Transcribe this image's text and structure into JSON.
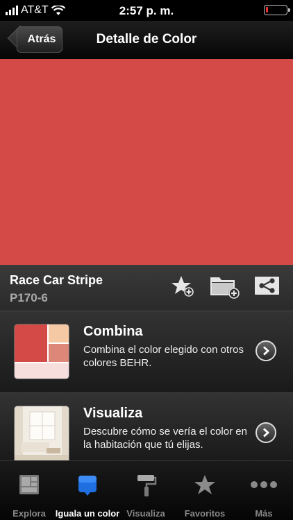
{
  "status_bar": {
    "carrier": "AT&T",
    "time": "2:57 p. m."
  },
  "nav": {
    "back_label": "Atrás",
    "title": "Detalle de Color"
  },
  "color": {
    "hex": "#d44a47",
    "name": "Race Car Stripe",
    "code": "P170-6"
  },
  "palette": {
    "main": "#d44a47",
    "light_peach": "#f6c9a5",
    "coral": "#dd8778",
    "pale_pink": "#f6dedc"
  },
  "actions": {
    "favorite_icon": "star-plus-icon",
    "folder_icon": "folder-plus-icon",
    "share_icon": "share-icon"
  },
  "features": [
    {
      "title": "Combina",
      "description": "Combina el color elegido con otros colores BEHR."
    },
    {
      "title": "Visualiza",
      "description": "Descubre cómo se vería el color en la habitación que tú elijas."
    }
  ],
  "tabs": [
    {
      "label": "Explora",
      "icon": "explore-icon",
      "active": false
    },
    {
      "label": "Iguala un color",
      "icon": "color-match-icon",
      "active": true
    },
    {
      "label": "Visualiza",
      "icon": "paint-roller-icon",
      "active": false
    },
    {
      "label": "Favoritos",
      "icon": "star-icon",
      "active": false
    },
    {
      "label": "Más",
      "icon": "more-icon",
      "active": false
    }
  ],
  "accent_colors": {
    "active_tab": "#1f6fe0",
    "inactive_tab": "#888888"
  }
}
